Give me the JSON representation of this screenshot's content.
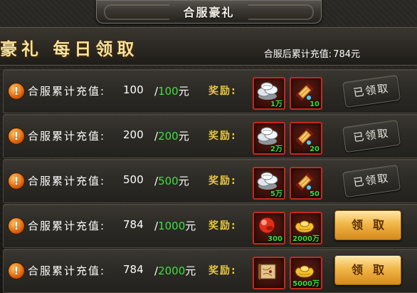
{
  "header": {
    "title": "合服豪礼"
  },
  "banner": {
    "title": "豪礼 每日领取",
    "total_label": "合服后累计充值:",
    "total_value": "784元"
  },
  "rows": [
    {
      "label": "合服累计充值:",
      "current": "100",
      "slash": "/",
      "target": "100",
      "unit": "元",
      "reward_label": "奖励:",
      "items": [
        {
          "icon": "silver-ingots-icon",
          "qty": "1万"
        },
        {
          "icon": "scroll-icon",
          "qty": "10"
        }
      ],
      "action": {
        "type": "claimed",
        "label": "已领取"
      }
    },
    {
      "label": "合服累计充值:",
      "current": "200",
      "slash": "/",
      "target": "200",
      "unit": "元",
      "reward_label": "奖励:",
      "items": [
        {
          "icon": "silver-ingots-icon",
          "qty": "2万"
        },
        {
          "icon": "scroll-icon",
          "qty": "20"
        }
      ],
      "action": {
        "type": "claimed",
        "label": "已领取"
      }
    },
    {
      "label": "合服累计充值:",
      "current": "500",
      "slash": "/",
      "target": "500",
      "unit": "元",
      "reward_label": "奖励:",
      "items": [
        {
          "icon": "silver-ingots-icon",
          "qty": "5万"
        },
        {
          "icon": "scroll-icon",
          "qty": "50"
        }
      ],
      "action": {
        "type": "claimed",
        "label": "已领取"
      }
    },
    {
      "label": "合服累计充值:",
      "current": "784",
      "slash": "/",
      "target": "1000",
      "unit": "元",
      "reward_label": "奖励:",
      "items": [
        {
          "icon": "red-gem-icon",
          "qty": "300"
        },
        {
          "icon": "gold-ingot-icon",
          "qty": "2000万"
        }
      ],
      "action": {
        "type": "claim",
        "label": "领取"
      }
    },
    {
      "label": "合服累计充值:",
      "current": "784",
      "slash": "/",
      "target": "2000",
      "unit": "元",
      "reward_label": "奖励:",
      "items": [
        {
          "icon": "treasure-map-icon",
          "qty": ""
        },
        {
          "icon": "gold-ingot-icon",
          "qty": "5000万"
        }
      ],
      "action": {
        "type": "claim",
        "label": "领取"
      }
    }
  ],
  "colors": {
    "achieved_target": "#3ee03e",
    "reward_label": "#e6c640",
    "item_border": "#c42a1c",
    "claim_button": "#f1b648"
  }
}
